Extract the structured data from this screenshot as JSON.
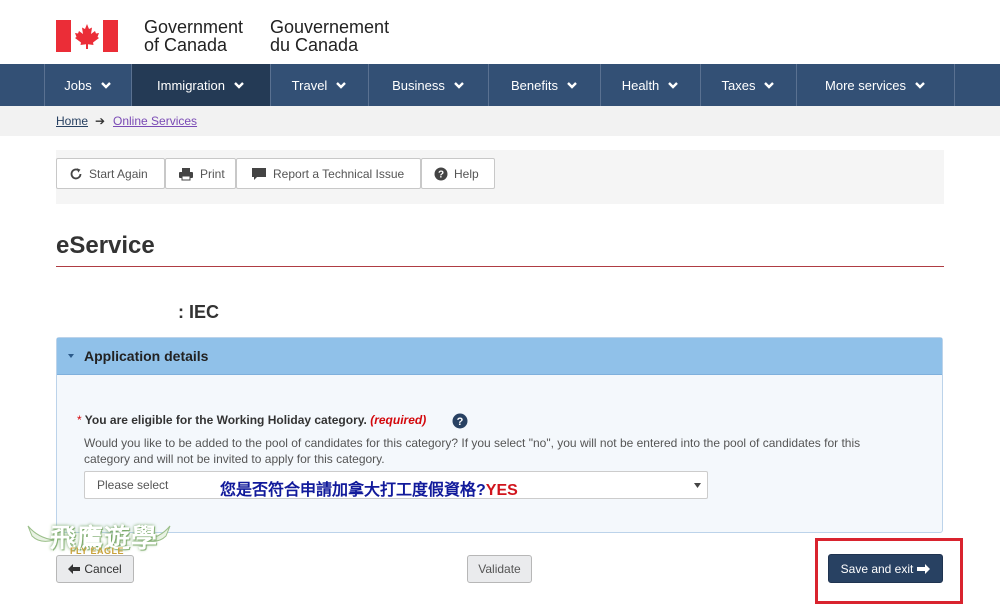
{
  "header": {
    "gov_en_line1": "Government",
    "gov_en_line2": "of Canada",
    "gov_fr_line1": "Gouvernement",
    "gov_fr_line2": "du Canada"
  },
  "nav": {
    "items": [
      {
        "label": "Jobs"
      },
      {
        "label": "Immigration"
      },
      {
        "label": "Travel"
      },
      {
        "label": "Business"
      },
      {
        "label": "Benefits"
      },
      {
        "label": "Health"
      },
      {
        "label": "Taxes"
      },
      {
        "label": "More services"
      }
    ]
  },
  "breadcrumb": {
    "home": "Home",
    "current": "Online Services"
  },
  "toolbar": {
    "start_again": "Start Again",
    "print": "Print",
    "report": "Report a Technical Issue",
    "help": "Help"
  },
  "page": {
    "title": "eService",
    "service_name": ": IEC"
  },
  "panel": {
    "title": "Application details",
    "field_label": "You are eligible for the Working Holiday category.",
    "required_text": "(required)",
    "description": "Would you like to be added to the pool of candidates for this category? If you select \"no\", you will not be entered into the pool of candidates for this category and will not be invited to apply for this category.",
    "select_value": "Please select",
    "annotation": "您是否符合申請加拿大打工度假資格?",
    "annotation_yes": "YES"
  },
  "watermark": {
    "text": "飛鷹遊學",
    "sub": "FLY EAGLE"
  },
  "buttons": {
    "cancel": "Cancel",
    "validate": "Validate",
    "save_exit": "Save and exit"
  },
  "colors": {
    "nav_bg": "#335075",
    "nav_active": "#243a55",
    "accent_red": "#af3c43",
    "panel_header": "#90c1e9",
    "save_button": "#284162",
    "highlight": "#d9232e"
  }
}
